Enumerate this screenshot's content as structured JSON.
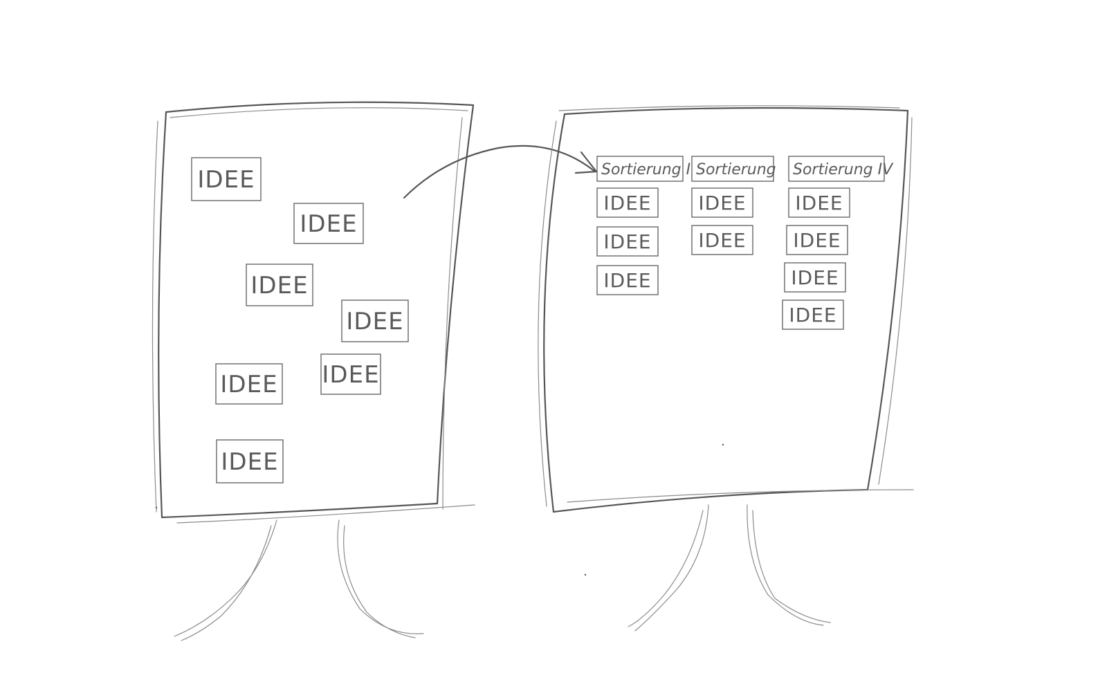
{
  "left_board": {
    "ideas": [
      "IDEE",
      "IDEE",
      "IDEE",
      "IDEE",
      "IDEE",
      "IDEE",
      "IDEE"
    ]
  },
  "right_board": {
    "columns": [
      {
        "header": "Sortierung I",
        "ideas": [
          "IDEE",
          "IDEE",
          "IDEE"
        ]
      },
      {
        "header": "Sortierung",
        "ideas": [
          "IDEE",
          "IDEE"
        ]
      },
      {
        "header": "Sortierung IV",
        "ideas": [
          "IDEE",
          "IDEE",
          "IDEE",
          "IDEE"
        ]
      }
    ]
  }
}
